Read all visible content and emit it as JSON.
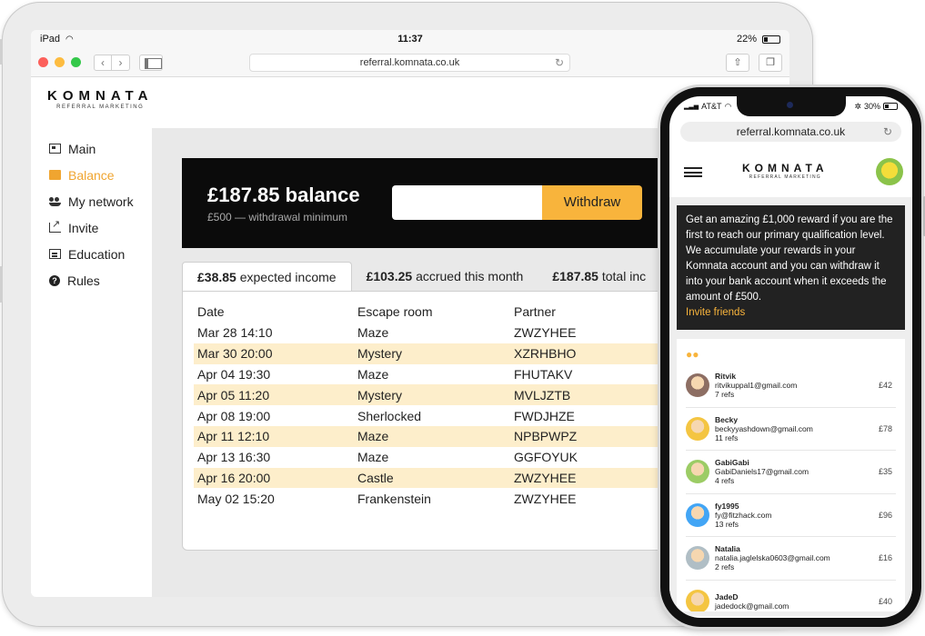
{
  "ipad": {
    "status": {
      "device": "iPad",
      "time": "11:37",
      "battery": "22%",
      "battery_level": 0.22
    },
    "browser": {
      "url": "referral.komnata.co.uk"
    },
    "brand": {
      "name": "KOMNATA",
      "tagline": "REFERRAL MARKETING"
    },
    "sidebar": {
      "items": [
        {
          "label": "Main",
          "icon": "main-icon"
        },
        {
          "label": "Balance",
          "icon": "wallet-icon"
        },
        {
          "label": "My network",
          "icon": "network-icon"
        },
        {
          "label": "Invite",
          "icon": "invite-icon"
        },
        {
          "label": "Education",
          "icon": "education-icon"
        },
        {
          "label": "Rules",
          "icon": "rules-icon"
        }
      ],
      "active": "Balance"
    },
    "balance": {
      "amount": "£187.85",
      "amount_suffix": "balance",
      "minimum": "£500 — withdrawal minimum",
      "withdraw_label": "Withdraw"
    },
    "tabs": [
      {
        "value": "£38.85",
        "label": "expected income"
      },
      {
        "value": "£103.25",
        "label": "accrued this month"
      },
      {
        "value": "£187.85",
        "label": "total inc"
      }
    ],
    "table": {
      "columns": [
        "Date",
        "Escape room",
        "Partner"
      ],
      "rows": [
        [
          "Mar 28 14:10",
          "Maze",
          "ZWZYHEE"
        ],
        [
          "Mar 30 20:00",
          "Mystery",
          "XZRHBHO"
        ],
        [
          "Apr 04 19:30",
          "Maze",
          "FHUTAKV"
        ],
        [
          "Apr 05 11:20",
          "Mystery",
          "MVLJZTB"
        ],
        [
          "Apr 08 19:00",
          "Sherlocked",
          "FWDJHZE"
        ],
        [
          "Apr 11 12:10",
          "Maze",
          "NPBPWPZ"
        ],
        [
          "Apr 13 16:30",
          "Maze",
          "GGFOYUK"
        ],
        [
          "Apr 16 20:00",
          "Castle",
          "ZWZYHEE"
        ],
        [
          "May 02 15:20",
          "Frankenstein",
          "ZWZYHEE"
        ]
      ]
    }
  },
  "iphone": {
    "status": {
      "carrier": "AT&T",
      "battery": "30%",
      "battery_level": 0.3
    },
    "browser": {
      "url": "referral.komnata.co.uk"
    },
    "brand": {
      "name": "KOMNATA",
      "tagline": "REFERRAL MARKETING"
    },
    "promo": {
      "text": "Get an amazing £1,000 reward if you are the first to reach our primary qualification level. We accumulate your rewards in your Komnata account and you can withdraw it into your bank account when it exceeds the amount of £500.",
      "link": "Invite friends"
    },
    "referrals": [
      {
        "name": "Ritvik",
        "email": "ritvikuppal1@gmail.com",
        "refs": "7 refs",
        "amount": "£42",
        "color": "#8d6e63"
      },
      {
        "name": "Becky",
        "email": "beckyyashdown@gmail.com",
        "refs": "11 refs",
        "amount": "£78",
        "color": "#f4c542"
      },
      {
        "name": "GabiGabi",
        "email": "GabiDaniels17@gmail.com",
        "refs": "4 refs",
        "amount": "£35",
        "color": "#9ccc65"
      },
      {
        "name": "fy1995",
        "email": "fy@fitzhack.com",
        "refs": "13 refs",
        "amount": "£96",
        "color": "#42a5f5"
      },
      {
        "name": "Natalia",
        "email": "natalia.jaglelska0603@gmail.com",
        "refs": "2 refs",
        "amount": "£16",
        "color": "#b0bec5"
      },
      {
        "name": "JadeD",
        "email": "jadedock@gmail.com",
        "refs": "",
        "amount": "£40",
        "color": "#f4c542"
      }
    ]
  },
  "colors": {
    "accent": "#f8b43c",
    "highlight_row": "#fdeecb",
    "dark": "#0b0b0b"
  }
}
